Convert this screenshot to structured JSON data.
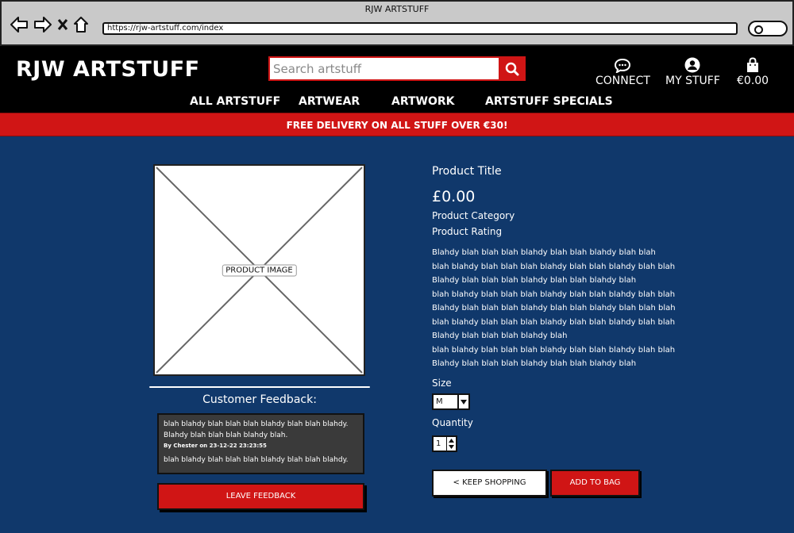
{
  "browser": {
    "window_title": "RJW ARTSTUFF",
    "url": "https://rjw-artstuff.com/index"
  },
  "header": {
    "logo": "RJW ARTSTUFF",
    "search_placeholder": "Search artstuff",
    "connect_label": "CONNECT",
    "mystuff_label": "MY STUFF",
    "bag_total": "€0.00"
  },
  "nav": {
    "items": [
      "ALL ARTSTUFF",
      "ARTWEAR",
      "ARTWORK",
      "ARTSTUFF SPECIALS"
    ]
  },
  "banner": {
    "text": "FREE DELIVERY ON ALL STUFF OVER €30!"
  },
  "product": {
    "image_label": "PRODUCT IMAGE",
    "title": "Product Title",
    "price": "£0.00",
    "category": "Product Category",
    "rating": "Product Rating",
    "description_lines": [
      "Blahdy blah blah blah blahdy blah blah blahdy blah blah",
      "blah blahdy blah blah blah blahdy blah blah blahdy blah blah",
      "Blahdy blah blah blah blahdy blah blah blahdy blah",
      "blah blahdy blah blah blah blahdy blah blah blahdy blah blah",
      "Blahdy blah blah blah blahdy blah blah blahdy blah blah blah",
      "blah blahdy blah blah blah blahdy blah blah blahdy blah blah",
      "Blahdy blah blah blah blahdy blah",
      "blah blahdy blah blah blah blahdy blah blah blahdy blah blah",
      "Blahdy blah blah blah blahdy blah blah blahdy blah"
    ],
    "size_label": "Size",
    "size_value": "M",
    "quantity_label": "Quantity",
    "quantity_value": "1",
    "keep_shopping_label": "< KEEP SHOPPING",
    "add_to_bag_label": "ADD TO BAG"
  },
  "feedback": {
    "title": "Customer Feedback:",
    "line1": "blah blahdy blah blah blah blahdy blah blah blahdy.",
    "line2": "Blahdy blah blah blah blahdy blah.",
    "byline": "By Chester on 23-12-22 23:23:55",
    "line3": "blah blahdy blah blah blah blahdy blah blah blahdy.",
    "leave_label": "LEAVE FEEDBACK"
  },
  "colors": {
    "accent_red": "#d01515",
    "page_blue": "#10386b",
    "header_black": "#000000"
  }
}
